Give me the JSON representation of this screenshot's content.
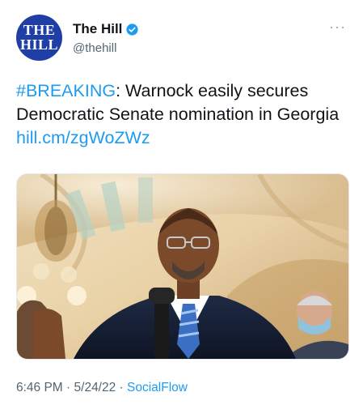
{
  "account": {
    "avatar_line1": "THE",
    "avatar_line2": "HILL",
    "display_name": "The Hill",
    "handle": "@thehill",
    "more_label": "···"
  },
  "tweet": {
    "hashtag": "#BREAKING",
    "body": ": Warnock easily secures Democratic Senate nomination in Georgia ",
    "link_text": "hill.cm/zgWoZWz"
  },
  "meta": {
    "time": "6:46 PM",
    "separator": " · ",
    "date": "5/24/22",
    "source": "SocialFlow"
  },
  "colors": {
    "link": "#1d9bf0",
    "verified": "#1d9bf0",
    "avatar_bg": "#1f3fa6",
    "secondary_text": "#536471"
  },
  "icons": {
    "verified": "verified-badge-icon",
    "more": "more-options-icon"
  }
}
